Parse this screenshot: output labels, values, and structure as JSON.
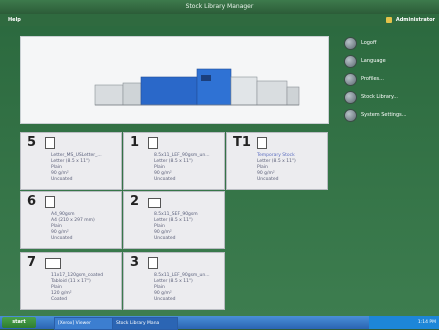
{
  "window": {
    "title": "Stock Library Manager"
  },
  "menu": {
    "help": "Help",
    "user": "Administrator"
  },
  "side_buttons": [
    "Logoff",
    "Language",
    "Profiles...",
    "Stock Library...",
    "System Settings..."
  ],
  "trays": [
    {
      "num": "5",
      "name": "Letter_MS_USLetter_...",
      "size": "Letter (8.5 x 11\")",
      "type": "Plain",
      "weight": "90 g/m²",
      "coating": "Uncoated"
    },
    {
      "num": "1",
      "name": "8.5x11_LEF_90gsm_un...",
      "size": "Letter (8.5 x 11\")",
      "type": "Plain",
      "weight": "90 g/m²",
      "coating": "Uncoated"
    },
    {
      "num": "T1",
      "name": "Temporary Stock",
      "size": "Letter (8.5 x 11\")",
      "type": "Plain",
      "weight": "90 g/m²",
      "coating": "Uncoated"
    },
    {
      "num": "6",
      "name": "A4_90gsm",
      "size": "A4 (210 x 297 mm)",
      "type": "Plain",
      "weight": "90 g/m²",
      "coating": "Uncoated"
    },
    {
      "num": "2",
      "name": "8.5x11_SEF_90gsm",
      "size": "Letter (8.5 x 11\")",
      "type": "Plain",
      "weight": "90 g/m²",
      "coating": "Uncoated"
    },
    {
      "num": "7",
      "name": "11x17_120gsm_coated",
      "size": "Tabloid (11 x 17\")",
      "type": "Plain",
      "weight": "120 g/m²",
      "coating": "Coated"
    },
    {
      "num": "3",
      "name": "8.5x11_LEF_90gsm_un...",
      "size": "Letter (8.5 x 11\")",
      "type": "Plain",
      "weight": "90 g/m²",
      "coating": "Uncoated"
    }
  ],
  "taskbar": {
    "start": "start",
    "task1": "[Xerox] Viewer",
    "task2": "Stock Library Mana",
    "clock": "1:14 PM"
  }
}
